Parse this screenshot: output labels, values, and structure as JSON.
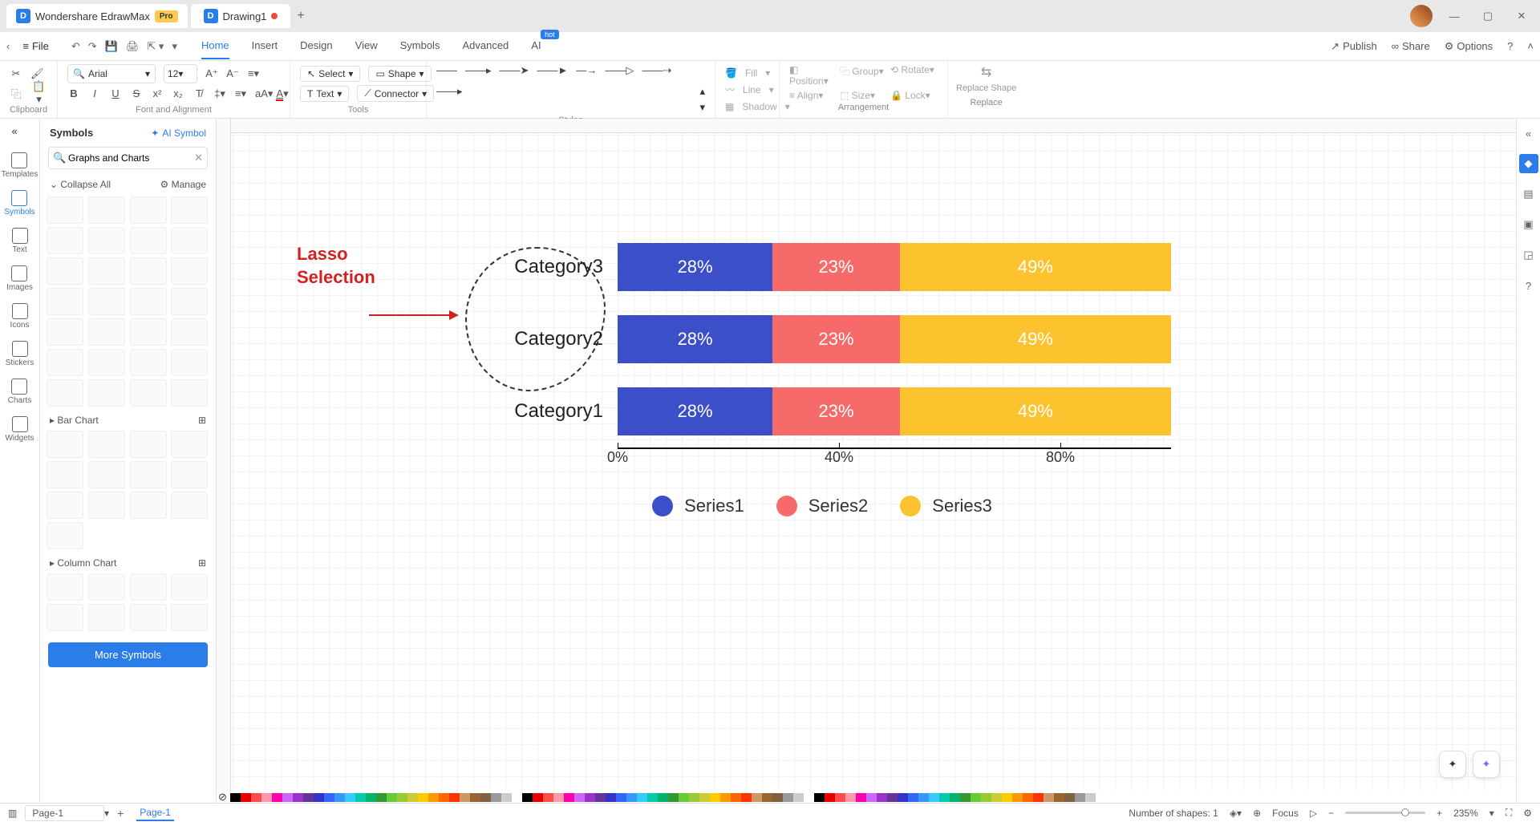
{
  "titlebar": {
    "app_name": "Wondershare EdrawMax",
    "pro_badge": "Pro",
    "doc_name": "Drawing1"
  },
  "menubar": {
    "file": "File",
    "tabs": [
      "Home",
      "Insert",
      "Design",
      "View",
      "Symbols",
      "Advanced",
      "AI"
    ],
    "active_tab": "Home",
    "hot_label": "hot",
    "publish": "Publish",
    "share": "Share",
    "options": "Options"
  },
  "ribbon": {
    "clipboard_label": "Clipboard",
    "font_label": "Font and Alignment",
    "tools_label": "Tools",
    "styles_label": "Styles",
    "arrangement_label": "Arrangement",
    "replace_label": "Replace",
    "font_name": "Arial",
    "font_size": "12",
    "select": "Select",
    "shape": "Shape",
    "text": "Text",
    "connector": "Connector",
    "fill": "Fill",
    "line": "Line",
    "shadow": "Shadow",
    "position": "Position",
    "align": "Align",
    "group": "Group",
    "size": "Size",
    "rotate": "Rotate",
    "lock": "Lock",
    "replace_shape": "Replace Shape"
  },
  "left_rail": {
    "templates": "Templates",
    "symbols": "Symbols",
    "text": "Text",
    "images": "Images",
    "icons": "Icons",
    "stickers": "Stickers",
    "charts": "Charts",
    "widgets": "Widgets"
  },
  "symbols_panel": {
    "title": "Symbols",
    "ai_symbol": "AI Symbol",
    "search_value": "Graphs and Charts",
    "collapse": "Collapse All",
    "manage": "Manage",
    "bar_chart": "Bar Chart",
    "column_chart": "Column Chart",
    "more_symbols": "More Symbols"
  },
  "canvas": {
    "annotation_line1": "Lasso",
    "annotation_line2": "Selection"
  },
  "chart_data": {
    "type": "bar",
    "orientation": "horizontal",
    "stacked": true,
    "categories": [
      "Category3",
      "Category2",
      "Category1"
    ],
    "series": [
      {
        "name": "Series1",
        "values": [
          28,
          28,
          28
        ],
        "color": "#3b4fc9"
      },
      {
        "name": "Series2",
        "values": [
          23,
          23,
          23
        ],
        "color": "#f76a6a"
      },
      {
        "name": "Series3",
        "values": [
          49,
          49,
          49
        ],
        "color": "#fcc32e"
      }
    ],
    "xlabel": "",
    "ylabel": "",
    "x_ticks": [
      "0%",
      "40%",
      "80%"
    ],
    "xlim": [
      0,
      100
    ]
  },
  "statusbar": {
    "page_selector": "Page-1",
    "page_tab": "Page-1",
    "shapes": "Number of shapes: 1",
    "focus": "Focus",
    "zoom": "235%"
  }
}
